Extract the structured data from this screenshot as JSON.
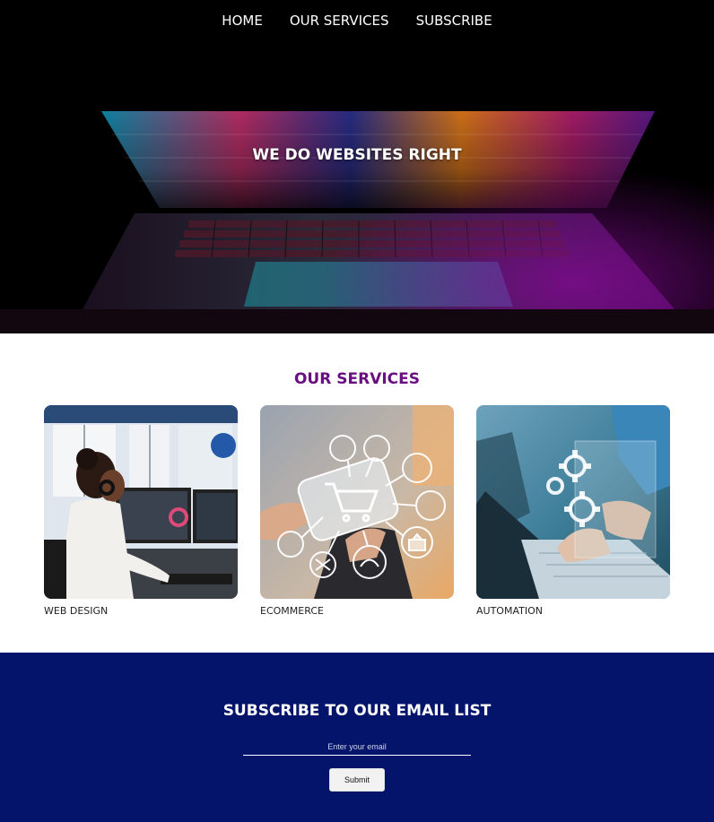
{
  "nav": {
    "items": [
      {
        "label": "HOME"
      },
      {
        "label": "OUR SERVICES"
      },
      {
        "label": "SUBSCRIBE"
      }
    ]
  },
  "hero": {
    "title": "WE DO WEBSITES RIGHT",
    "image": "laptop-photo"
  },
  "services": {
    "title": "OUR SERVICES",
    "items": [
      {
        "label": "WEB DESIGN",
        "image": "woman-at-computer-photo"
      },
      {
        "label": "ECOMMERCE",
        "image": "ecommerce-icons-photo"
      },
      {
        "label": "AUTOMATION",
        "image": "gears-laptop-photo"
      }
    ]
  },
  "subscribe": {
    "title": "SUBSCRIBE TO OUR EMAIL LIST",
    "email_placeholder": "Enter your email",
    "submit_label": "Submit"
  },
  "colors": {
    "services_title": "#6a0f82",
    "subscribe_bg": "#05146b",
    "hero_bg": "#000000"
  }
}
